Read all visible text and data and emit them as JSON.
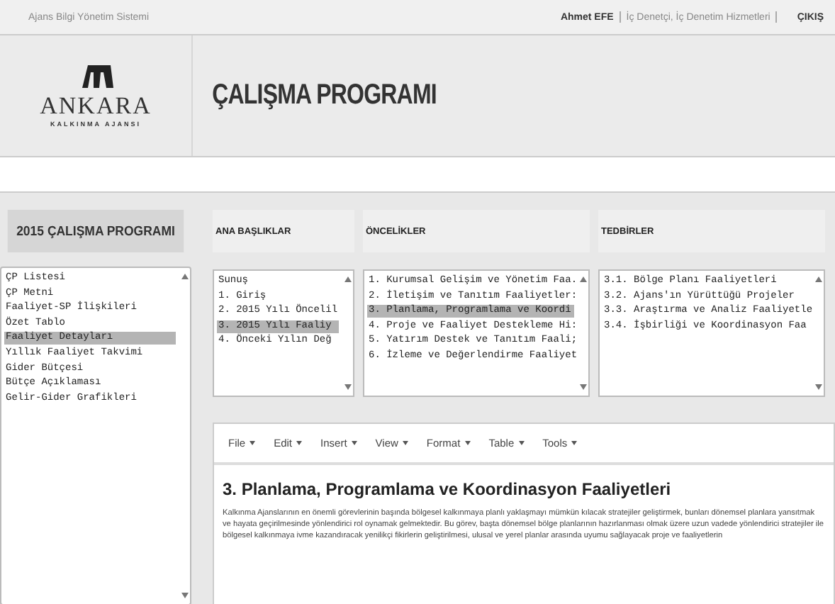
{
  "top_bar": {
    "system_name": "Ajans Bilgi Yönetim Sistemi",
    "user": "Ahmet EFE",
    "role": "İç Denetçi, İç Denetim Hizmetleri",
    "logout": "ÇIKIŞ"
  },
  "logo": {
    "name": "ANKARA",
    "subtitle": "KALKINMA AJANSI"
  },
  "page_title": "ÇALIŞMA PROGRAMI",
  "sidebar": {
    "title": "2015 ÇALIŞMA PROGRAMI",
    "items": [
      {
        "label": "ÇP Listesi",
        "selected": false
      },
      {
        "label": "ÇP Metni",
        "selected": false
      },
      {
        "label": "Faaliyet-SP İlişkileri",
        "selected": false
      },
      {
        "label": "Özet Tablo",
        "selected": false
      },
      {
        "label": "Faaliyet Detayları",
        "selected": true
      },
      {
        "label": "Yıllık Faaliyet Takvimi",
        "selected": false
      },
      {
        "label": "Gider Bütçesi",
        "selected": false
      },
      {
        "label": "Bütçe Açıklaması",
        "selected": false
      },
      {
        "label": "Gelir-Gider Grafikleri",
        "selected": false
      }
    ]
  },
  "columns": [
    {
      "title": "ANA BAŞLIKLAR",
      "items": [
        {
          "label": "Sunuş",
          "selected": false
        },
        {
          "label": "1. Giriş",
          "selected": false
        },
        {
          "label": "2. 2015 Yılı Öncelil",
          "selected": false
        },
        {
          "label": "3. 2015 Yılı Faaliy",
          "selected": true
        },
        {
          "label": "4. Önceki Yılın Değ",
          "selected": false
        }
      ]
    },
    {
      "title": "ÖNCELİKLER",
      "items": [
        {
          "label": "1. Kurumsal Gelişim ve Yönetim Faa.",
          "selected": false
        },
        {
          "label": "2. İletişim ve Tanıtım Faaliyetler:",
          "selected": false
        },
        {
          "label": "3. Planlama, Programlama ve Koordi",
          "selected": true
        },
        {
          "label": "4. Proje ve Faaliyet Destekleme Hi:",
          "selected": false
        },
        {
          "label": "5. Yatırım Destek ve Tanıtım Faali;",
          "selected": false
        },
        {
          "label": "6. İzleme ve Değerlendirme Faaliyet",
          "selected": false
        }
      ]
    },
    {
      "title": "TEDBİRLER",
      "items": [
        {
          "label": "3.1. Bölge Planı Faaliyetleri",
          "selected": false
        },
        {
          "label": "3.2. Ajans'ın Yürüttüğü Projeler",
          "selected": false
        },
        {
          "label": "3.3. Araştırma ve Analiz Faaliyetle",
          "selected": false
        },
        {
          "label": "3.4. İşbirliği ve Koordinasyon Faa",
          "selected": false
        }
      ]
    }
  ],
  "editor": {
    "menu": [
      "File",
      "Edit",
      "Insert",
      "View",
      "Format",
      "Table",
      "Tools"
    ],
    "heading": "3. Planlama, Programlama ve Koordinasyon Faaliyetleri",
    "body": "Kalkınma Ajanslarının en önemli görevlerinin başında bölgesel kalkınmaya planlı yaklaşmayı mümkün kılacak stratejiler geliştirmek, bunları dönemsel planlara yansıtmak ve hayata geçirilmesinde yönlendirici rol oynamak gelmektedir. Bu görev, başta dönemsel bölge planlarının hazırlanması olmak üzere uzun vadede yönlendirici stratejiler ile bölgesel kalkınmaya ivme kazandıracak yenilikçi fikirlerin geliştirilmesi, ulusal ve yerel planlar arasında uyumu sağlayacak proje ve faaliyetlerin"
  }
}
